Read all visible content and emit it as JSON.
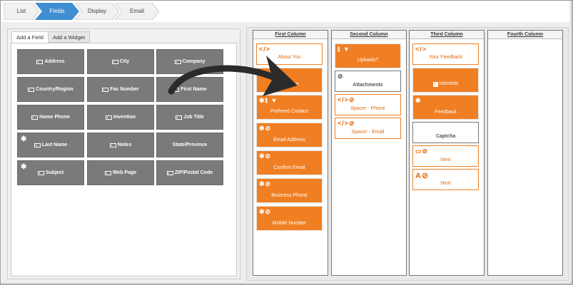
{
  "wizard": {
    "steps": [
      "List",
      "Fields",
      "Display",
      "Email"
    ],
    "active_step": "Fields"
  },
  "left": {
    "tabs": [
      "Add a Field",
      "Add a Widget"
    ],
    "fields": [
      {
        "label": "Address"
      },
      {
        "label": "City"
      },
      {
        "label": "Company"
      },
      {
        "label": "Country/Region"
      },
      {
        "label": "Fax Number"
      },
      {
        "label": "First Name"
      },
      {
        "label": "Home Phone"
      },
      {
        "label": "Invention"
      },
      {
        "label": "Job Title"
      },
      {
        "label": "Last Name",
        "required": "✱"
      },
      {
        "label": "Notes"
      },
      {
        "label": "State/Province"
      },
      {
        "label": "Subject",
        "required": "✱"
      },
      {
        "label": "Web Page"
      },
      {
        "label": "ZIP/Postal Code"
      }
    ]
  },
  "columns": [
    {
      "title": "First Column",
      "items": [
        {
          "label": "About You",
          "sym": "</>"
        },
        {
          "label": "Name",
          "sym": ""
        },
        {
          "label": "Prefered Contact",
          "sym": "✱ℹ ▼"
        },
        {
          "label": "Email Address",
          "sym": "✱⊘"
        },
        {
          "label": "Confirm Email",
          "sym": "✱⊘"
        },
        {
          "label": "Business Phone",
          "sym": "✱⊘"
        },
        {
          "label": "Mobile Number",
          "sym": "✱⊘"
        }
      ]
    },
    {
      "title": "Second Column",
      "items": [
        {
          "label": "Uploads?",
          "sym": "ℹ ▼"
        },
        {
          "label": "Attachments",
          "sym": "⊘"
        },
        {
          "label": "Spacer - Phone",
          "sym": "</>⊘"
        },
        {
          "label": "Spacer - Email",
          "sym": "</>⊘"
        }
      ]
    },
    {
      "title": "Third Column",
      "items": [
        {
          "label": "Your Feedback",
          "sym": "</>"
        },
        {
          "label": "Interests",
          "sym": ""
        },
        {
          "label": "Feedback",
          "sym": "✱"
        },
        {
          "label": "Captcha",
          "sym": ""
        },
        {
          "label": "Next",
          "sym": "▭⊘"
        },
        {
          "label": "Next",
          "sym": "A⊘"
        }
      ]
    },
    {
      "title": "Fourth Column",
      "items": []
    }
  ],
  "colors": {
    "accent": "#f07f23",
    "tile": "#7a7a7a",
    "step_active": "#3f8ed2"
  }
}
